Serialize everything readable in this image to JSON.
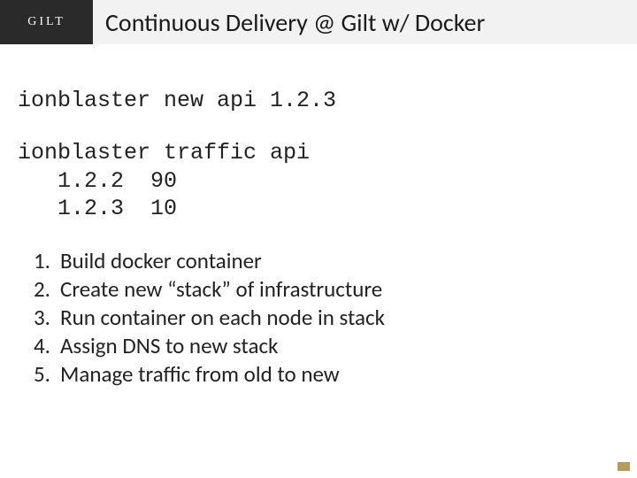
{
  "header": {
    "logo": "GILT",
    "title": "Continuous Delivery @ Gilt w/ Docker"
  },
  "commands": {
    "block1": "ionblaster new api 1.2.3",
    "block2": "ionblaster traffic api\n   1.2.2  90\n   1.2.3  10"
  },
  "steps": [
    "Build docker container",
    "Create new “stack” of infrastructure",
    "Run container on each node in stack",
    "Assign DNS to new stack",
    "Manage traffic from old to new"
  ]
}
